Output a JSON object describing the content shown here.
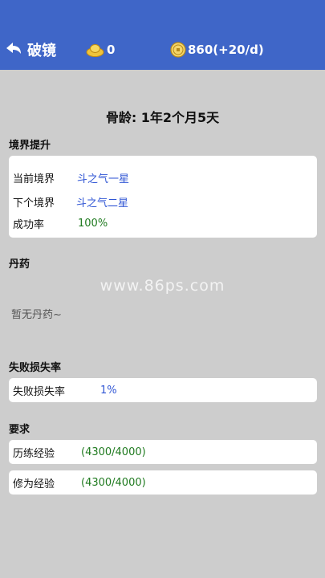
{
  "header": {
    "back_label": "破镜",
    "gold_value": "0",
    "coin_value": "860(+20/d)",
    "icons": {
      "back": "back-arrow-icon",
      "gold": "gold-ingot-icon",
      "coin": "coin-icon"
    }
  },
  "bone_age": "骨龄: 1年2个月5天",
  "realm": {
    "title": "境界提升",
    "rows": [
      {
        "label": "当前境界",
        "value": "斗之气一星"
      },
      {
        "label": "下个境界",
        "value": "斗之气二星"
      },
      {
        "label": "成功率",
        "value": "100%"
      }
    ]
  },
  "pills": {
    "title": "丹药",
    "empty_text": "暂无丹药~"
  },
  "watermark": "www.86ps.com",
  "failure": {
    "title": "失败损失率",
    "label": "失败损失率",
    "value": "1%"
  },
  "requirements": {
    "title": "要求",
    "rows": [
      {
        "label": "历练经验",
        "value": "(4300/4000)"
      },
      {
        "label": "修为经验",
        "value": "(4300/4000)"
      }
    ]
  },
  "colors": {
    "header_bg": "#3f66c8",
    "page_bg": "#cdcdcd",
    "link_blue": "#2f55d4",
    "ok_green": "#1f7a1f"
  }
}
